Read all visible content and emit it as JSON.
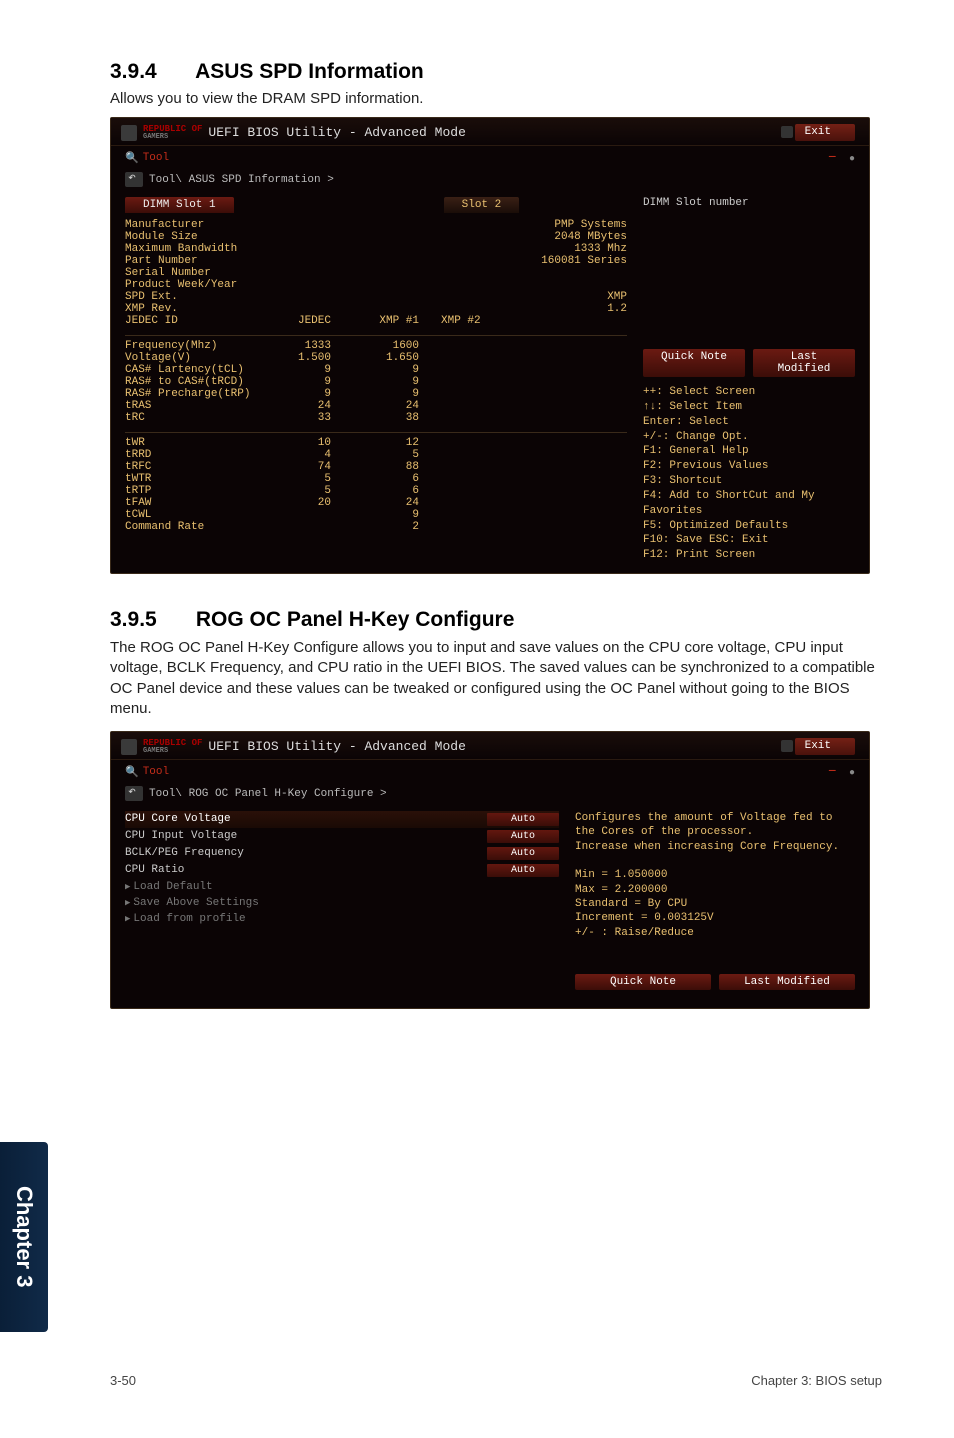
{
  "chapter_tab": "Chapter 3",
  "footer_left": "3-50",
  "footer_right": "Chapter 3: BIOS setup",
  "s394": {
    "num": "3.9.4",
    "title": "ASUS SPD Information",
    "lead": "Allows you to view the DRAM SPD information."
  },
  "s395": {
    "num": "3.9.5",
    "title": "ROG OC Panel H-Key Configure",
    "body": "The ROG OC Panel H-Key Configure allows you to input and save values on the CPU core voltage, CPU input voltage, BCLK Frequency, and CPU ratio in the UEFI BIOS. The saved values can be synchronized to a compatible OC Panel device and these values can be tweaked or configured using the OC Panel without going to the BIOS menu."
  },
  "bios1": {
    "logo_top": "REPUBLIC OF",
    "logo_bottom": "GAMERS",
    "app_title": "UEFI BIOS Utility - Advanced Mode",
    "exit": "Exit",
    "search": "Tool",
    "breadcrumb": "Tool\\ ASUS SPD Information >",
    "tabs": {
      "slot1": "DIMM Slot 1",
      "slot2": "Slot 2"
    },
    "side_label": "DIMM Slot number",
    "rows_top": [
      {
        "k": "Manufacturer",
        "v3": "PMP Systems"
      },
      {
        "k": "Module Size",
        "v3": "2048 MBytes"
      },
      {
        "k": "Maximum Bandwidth",
        "v3": "1333 Mhz"
      },
      {
        "k": "Part Number",
        "v3": "160081 Series"
      },
      {
        "k": "Serial Number",
        "v3": ""
      },
      {
        "k": "Product Week/Year",
        "v3": ""
      },
      {
        "k": "SPD Ext.",
        "v3": "XMP"
      },
      {
        "k": "XMP Rev.",
        "v3": "1.2"
      },
      {
        "k": "JEDEC ID",
        "v1": "JEDEC",
        "v2": "XMP #1",
        "v3": "XMP #2"
      }
    ],
    "rows_mid": [
      {
        "k": "Frequency(Mhz)",
        "v1": "1333",
        "v2": "1600"
      },
      {
        "k": "Voltage(V)",
        "v1": "1.500",
        "v2": "1.650"
      },
      {
        "k": "CAS# Lartency(tCL)",
        "v1": "9",
        "v2": "9"
      },
      {
        "k": "RAS# to CAS#(tRCD)",
        "v1": "9",
        "v2": "9"
      },
      {
        "k": "RAS# Precharge(tRP)",
        "v1": "9",
        "v2": "9"
      },
      {
        "k": "tRAS",
        "v1": "24",
        "v2": "24"
      },
      {
        "k": "tRC",
        "v1": "33",
        "v2": "38"
      }
    ],
    "rows_bot": [
      {
        "k": "tWR",
        "v1": "10",
        "v2": "12"
      },
      {
        "k": "tRRD",
        "v1": "4",
        "v2": "5"
      },
      {
        "k": "tRFC",
        "v1": "74",
        "v2": "88"
      },
      {
        "k": "tWTR",
        "v1": "5",
        "v2": "6"
      },
      {
        "k": "tRTP",
        "v1": "5",
        "v2": "6"
      },
      {
        "k": "tFAW",
        "v1": "20",
        "v2": "24"
      },
      {
        "k": "tCWL",
        "v1": "",
        "v2": "9"
      },
      {
        "k": "Command Rate",
        "v1": "",
        "v2": "2"
      }
    ],
    "pills": {
      "quick": "Quick Note",
      "last": "Last Modified"
    },
    "help": [
      "++: Select Screen",
      "↑↓: Select Item",
      "Enter: Select",
      "+/-: Change Opt.",
      "F1: General Help",
      "F2: Previous Values",
      "F3: Shortcut",
      "F4: Add to ShortCut and My Favorites",
      "F5: Optimized Defaults",
      "F10: Save  ESC: Exit",
      "F12: Print Screen"
    ]
  },
  "bios2": {
    "logo_top": "REPUBLIC OF",
    "logo_bottom": "GAMERS",
    "app_title": "UEFI BIOS Utility - Advanced Mode",
    "exit": "Exit",
    "search": "Tool",
    "breadcrumb": "Tool\\ ROG OC Panel H-Key Configure >",
    "desc": [
      "Configures the amount of Voltage fed to the Cores of the processor.",
      "Increase when increasing Core Frequency.",
      "",
      "Min = 1.050000",
      "Max = 2.200000",
      "Standard = By CPU",
      "Increment = 0.003125V",
      "+/- : Raise/Reduce"
    ],
    "options": [
      {
        "key": "CPU Core Voltage",
        "val": "Auto",
        "active": true
      },
      {
        "key": "CPU Input Voltage",
        "val": "Auto"
      },
      {
        "key": "BCLK/PEG Frequency",
        "val": "Auto"
      },
      {
        "key": "CPU Ratio",
        "val": "Auto"
      },
      {
        "key": "Load Default",
        "plain": true,
        "tri": true
      },
      {
        "key": "Save Above Settings",
        "plain": true,
        "tri": true
      },
      {
        "key": "Load from profile",
        "plain": true,
        "tri": true
      }
    ],
    "pills": {
      "quick": "Quick Note",
      "last": "Last Modified"
    }
  }
}
